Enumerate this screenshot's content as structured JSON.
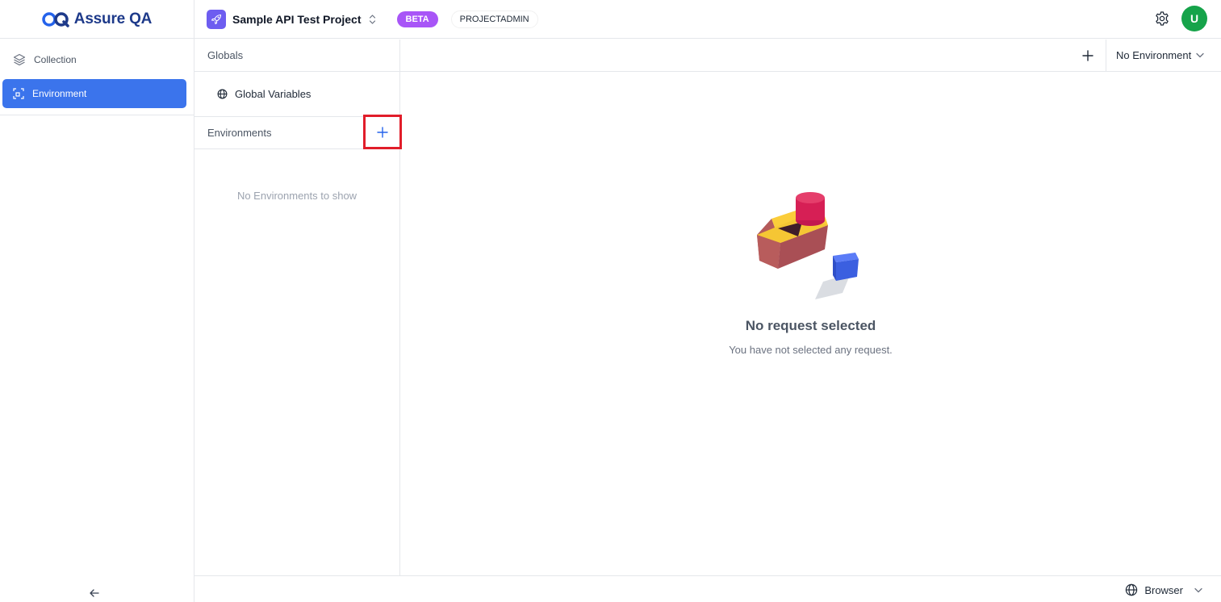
{
  "brand": {
    "name": "Assure QA"
  },
  "sidebar": {
    "items": [
      {
        "label": "Collection",
        "icon": "layers-icon",
        "active": false
      },
      {
        "label": "Environment",
        "icon": "environment-icon",
        "active": true
      }
    ],
    "collapse_icon": "arrow-left-icon"
  },
  "header": {
    "project_name": "Sample API Test Project",
    "badge": "BETA",
    "role": "PROJECTADMIN",
    "avatar_initial": "U",
    "colors": {
      "beta": "#a855f7",
      "avatar": "#16a34a",
      "project_icon": "#6d5df0"
    }
  },
  "env_panel": {
    "globals_header": "Globals",
    "global_variables_label": "Global Variables",
    "environments_header": "Environments",
    "empty_text": "No Environments to show"
  },
  "main": {
    "environment_select": "No Environment",
    "empty_title": "No request selected",
    "empty_subtitle": "You have not selected any request."
  },
  "footer": {
    "browser_label": "Browser"
  },
  "accent_color": "#3b74ec"
}
